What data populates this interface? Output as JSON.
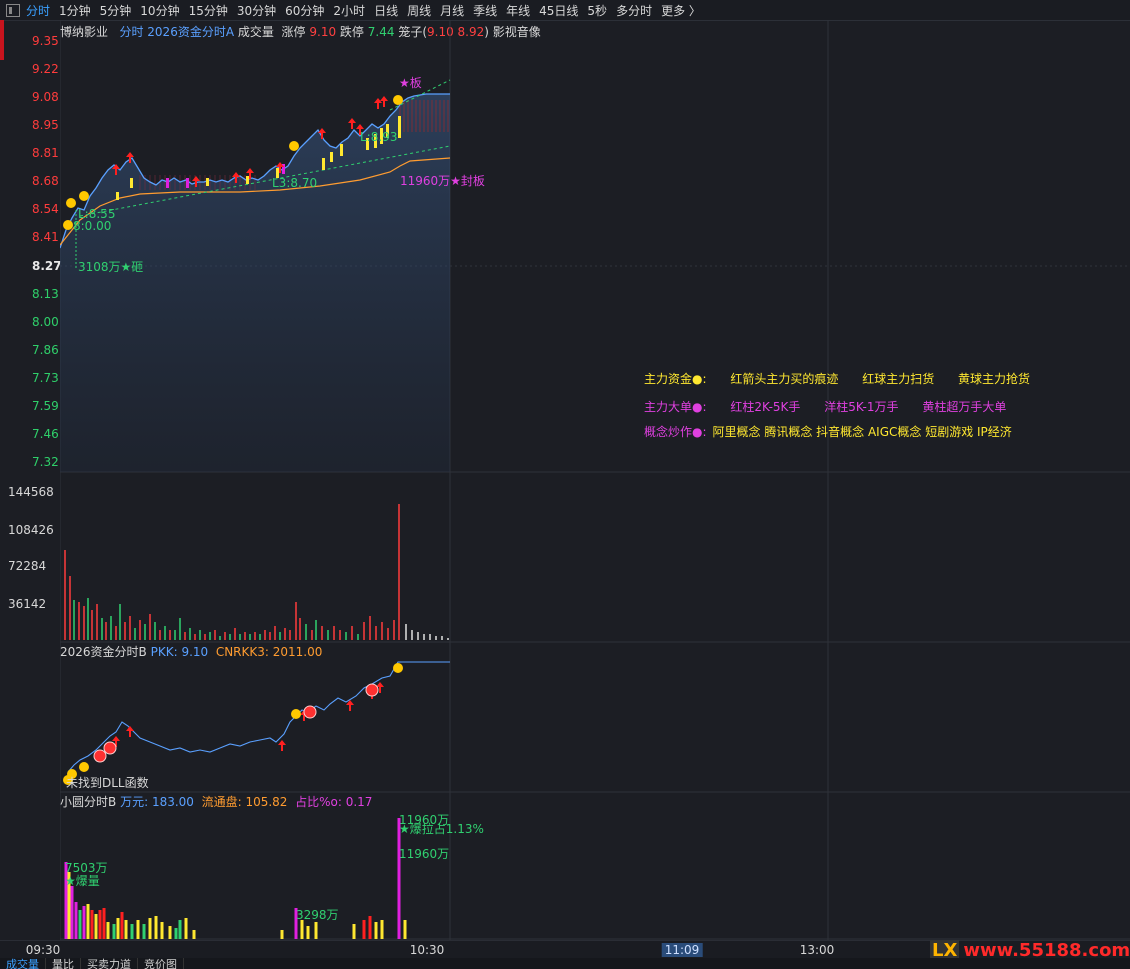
{
  "toolbar": {
    "items": [
      "分时",
      "1分钟",
      "5分钟",
      "10分钟",
      "15分钟",
      "30分钟",
      "60分钟",
      "2小时",
      "日线",
      "周线",
      "月线",
      "季线",
      "年线",
      "45日线",
      "5秒",
      "多分时",
      "更多 〉"
    ]
  },
  "main_header": {
    "stock": "博纳影业",
    "indicator": "分时 2026资金分时A",
    "vol_label": "成交量",
    "up_label": "涨停",
    "up_value": "9.10",
    "down_label": "跌停",
    "down_value": "7.44",
    "cage_label": "笼子(",
    "cage_values": "9.10 8.92",
    "cage_close": ")",
    "concept": "影视音像"
  },
  "price_axis": [
    "9.35",
    "9.22",
    "9.08",
    "8.95",
    "8.81",
    "8.68",
    "8.54",
    "8.41",
    "8.27",
    "8.13",
    "8.00",
    "7.86",
    "7.73",
    "7.59",
    "7.46",
    "7.32"
  ],
  "volume_axis": [
    "144568",
    "108426",
    "72284",
    "36142"
  ],
  "annotations": {
    "limit_star": "★板",
    "seal": "11960万★封板",
    "l1": "L3:8.70",
    "l2": "L:8.93",
    "l3": "L:8.55",
    "zero": "8:0.00",
    "smash": "3108万★砸",
    "burst1": "7503万",
    "burst1_tag": "★爆量",
    "v2": "3298万",
    "v3a": "11960万",
    "v3b": "★爆拉占1.13%",
    "v3c": "11960万",
    "dll": "未找到DLL函数"
  },
  "legend": {
    "row1": {
      "label": "主力资金●:",
      "items": [
        "红箭头主力买的痕迹",
        "红球主力扫货",
        "黄球主力抢货"
      ]
    },
    "row2": {
      "label": "主力大单●:",
      "items": [
        "红柱2K-5K手",
        "洋柱5K-1万手",
        "黄柱超万手大单"
      ]
    },
    "row3": {
      "label": "概念炒作●:",
      "items": [
        "阿里概念 腾讯概念 抖音概念 AIGC概念 短剧游戏 IP经济"
      ]
    }
  },
  "panel_b": {
    "name": "2026资金分时B",
    "pkk_label": "PKK:",
    "pkk_value": "9.10",
    "cn_label": "CNRKK3:",
    "cn_value": "2011.00"
  },
  "panel_c": {
    "name": "小圆分时B",
    "wy_label": "万元:",
    "wy_value": "183.00",
    "ltp_label": "流通盘:",
    "ltp_value": "105.82",
    "zb_label": "占比%o:",
    "zb_value": "0.17"
  },
  "time_axis": [
    "09:30",
    "10:30",
    "11:09",
    "13:00"
  ],
  "bottom_tabs": [
    "成交量",
    "量比",
    "买卖力道",
    "竞价图"
  ],
  "watermark": {
    "lx": "LX",
    "site": "www.55188.com"
  },
  "colors": {
    "up": "#ff3c3c",
    "down": "#2fd06a",
    "price_line": "#5aa0ff",
    "avg_line": "#ff9c30",
    "accent": "#3aa0ff"
  }
}
